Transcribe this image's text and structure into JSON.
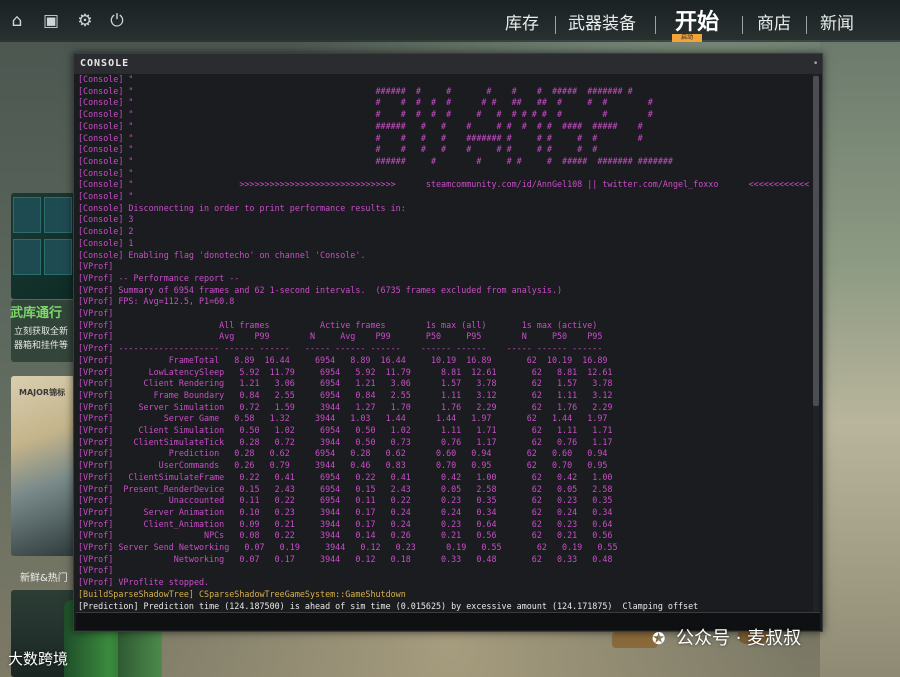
{
  "topnav": {
    "items": [
      {
        "label": "库存"
      },
      {
        "label": "武器装备"
      },
      {
        "label": "开始",
        "badge": "启动"
      },
      {
        "label": "商店"
      },
      {
        "label": "新闻"
      }
    ]
  },
  "left_panels": {
    "pass_title": "武库通行",
    "pass_line1": "立刻获取全新",
    "pass_line2": "器箱和挂件等",
    "major_title": "MAJOR锦标",
    "new_hot": "新鲜&热门"
  },
  "console": {
    "title": "CONSOLE",
    "input_value": "",
    "lines": [
      {
        "text": "[Console] \"",
        "cls": "c-console"
      },
      {
        "text": "[Console] \"                                                ######  #     #       #    #    #  #####  ####### #",
        "cls": "c-console"
      },
      {
        "text": "[Console] \"                                                #    #  #  #  #      # #   ##   ##  #     #  #        #",
        "cls": "c-console"
      },
      {
        "text": "[Console] \"                                                #    #  #  #  #     #   #  # # # #  #        #        #",
        "cls": "c-console"
      },
      {
        "text": "[Console] \"                                                ######   #   #    #     # #  #  # #  ####  #####    #",
        "cls": "c-console"
      },
      {
        "text": "[Console] \"                                                #    #   #   #    ####### #     # #     #  #        #",
        "cls": "c-console"
      },
      {
        "text": "[Console] \"                                                #    #   #   #    #     # #     # #     #  #",
        "cls": "c-console"
      },
      {
        "text": "[Console] \"                                                ######     #        #     # #     #  #####  ####### #######",
        "cls": "c-console"
      },
      {
        "text": "[Console] \"",
        "cls": "c-console"
      },
      {
        "text": "[Console] \"                     >>>>>>>>>>>>>>>>>>>>>>>>>>>>>>>      steamcommunity.com/id/AnnGel108 || twitter.com/Angel_foxxo      <<<<<<<<<<<<<<<<<<",
        "cls": "c-console"
      },
      {
        "text": "[Console] \"",
        "cls": "c-console"
      },
      {
        "text": "[Console] Disconnecting in order to print performance results in:",
        "cls": "c-console"
      },
      {
        "text": "[Console] 3",
        "cls": "c-console"
      },
      {
        "text": "[Console] 2",
        "cls": "c-console"
      },
      {
        "text": "[Console] 1",
        "cls": "c-console"
      },
      {
        "text": "[Console] Enabling flag 'donotecho' on channel 'Console'.",
        "cls": "c-console"
      },
      {
        "text": "[VProf]",
        "cls": "c-vprof"
      },
      {
        "text": "[VProf] -- Performance report --",
        "cls": "c-vprof"
      },
      {
        "text": "[VProf] Summary of 6954 frames and 62 1-second intervals.  (6735 frames excluded from analysis.)",
        "cls": "c-vprof"
      },
      {
        "text": "[VProf] FPS: Avg=112.5, P1=60.8",
        "cls": "c-vprof"
      },
      {
        "text": "[VProf]",
        "cls": "c-vprof"
      },
      {
        "text": "[VProf]                     All frames          Active frames        1s max (all)       1s max (active)",
        "cls": "c-vprof"
      },
      {
        "text": "[VProf]                     Avg    P99        N     Avg    P99       P50     P95        N     P50    P95",
        "cls": "c-vprof"
      },
      {
        "text": "[VProf] -------------------- ------ ------   ----- ------ ------    ------ ------    ----- ------ ------",
        "cls": "c-vprof"
      },
      {
        "text": "[VProf]           FrameTotal   8.89  16.44     6954   8.89  16.44     10.19  16.89       62  10.19  16.89",
        "cls": "c-vprof"
      },
      {
        "text": "[VProf]       LowLatencySleep   5.92  11.79     6954   5.92  11.79      8.81  12.61       62   8.81  12.61",
        "cls": "c-vprof"
      },
      {
        "text": "[VProf]      Client Rendering   1.21   3.06     6954   1.21   3.06      1.57   3.78       62   1.57   3.78",
        "cls": "c-vprof"
      },
      {
        "text": "[VProf]        Frame Boundary   0.84   2.55     6954   0.84   2.55      1.11   3.12       62   1.11   3.12",
        "cls": "c-vprof"
      },
      {
        "text": "[VProf]     Server Simulation   0.72   1.59     3944   1.27   1.70      1.76   2.29       62   1.76   2.29",
        "cls": "c-vprof"
      },
      {
        "text": "[VProf]          Server Game   0.58   1.32     3944   1.03   1.44      1.44   1.97       62   1.44   1.97",
        "cls": "c-vprof"
      },
      {
        "text": "[VProf]     Client Simulation   0.50   1.02     6954   0.50   1.02      1.11   1.71       62   1.11   1.71",
        "cls": "c-vprof"
      },
      {
        "text": "[VProf]    ClientSimulateTick   0.28   0.72     3944   0.50   0.73      0.76   1.17       62   0.76   1.17",
        "cls": "c-vprof"
      },
      {
        "text": "[VProf]           Prediction   0.28   0.62     6954   0.28   0.62      0.60   0.94       62   0.60   0.94",
        "cls": "c-vprof"
      },
      {
        "text": "[VProf]         UserCommands   0.26   0.79     3944   0.46   0.83      0.70   0.95       62   0.70   0.95",
        "cls": "c-vprof"
      },
      {
        "text": "[VProf]   ClientSimulateFrame   0.22   0.41     6954   0.22   0.41      0.42   1.00       62   0.42   1.00",
        "cls": "c-vprof"
      },
      {
        "text": "[VProf]  Present_RenderDevice   0.15   2.43     6954   0.15   2.43      0.05   2.58       62   0.05   2.58",
        "cls": "c-vprof"
      },
      {
        "text": "[VProf]           Unaccounted   0.11   0.22     6954   0.11   0.22      0.23   0.35       62   0.23   0.35",
        "cls": "c-vprof"
      },
      {
        "text": "[VProf]      Server Animation   0.10   0.23     3944   0.17   0.24      0.24   0.34       62   0.24   0.34",
        "cls": "c-vprof"
      },
      {
        "text": "[VProf]      Client_Animation   0.09   0.21     3944   0.17   0.24      0.23   0.64       62   0.23   0.64",
        "cls": "c-vprof"
      },
      {
        "text": "[VProf]                  NPCs   0.08   0.22     3944   0.14   0.26      0.21   0.56       62   0.21   0.56",
        "cls": "c-vprof"
      },
      {
        "text": "[VProf] Server Send Networking   0.07   0.19     3944   0.12   0.23      0.19   0.55       62   0.19   0.55",
        "cls": "c-vprof"
      },
      {
        "text": "[VProf]            Networking   0.07   0.17     3944   0.12   0.18      0.33   0.48       62   0.33   0.48",
        "cls": "c-vprof"
      },
      {
        "text": "[VProf]",
        "cls": "c-vprof"
      },
      {
        "text": "[VProf] VProflite stopped.",
        "cls": "c-vprof"
      },
      {
        "text": "[BuildSparseShadowTree] CSparseShadowTreeGameSystem::GameShutdown",
        "cls": "c-warn"
      },
      {
        "text": "[Prediction] Prediction time (124.187500) is ahead of sim time (0.015625) by excessive amount (124.171875)  Clamping offset",
        "cls": "c-white"
      }
    ]
  },
  "watermark": {
    "right": "公众号 · 麦叔叔",
    "left": "大数跨境"
  },
  "colors": {
    "console_magenta": "#c84ec8",
    "console_green": "#46c84e",
    "badge_orange": "#f2a33a"
  }
}
